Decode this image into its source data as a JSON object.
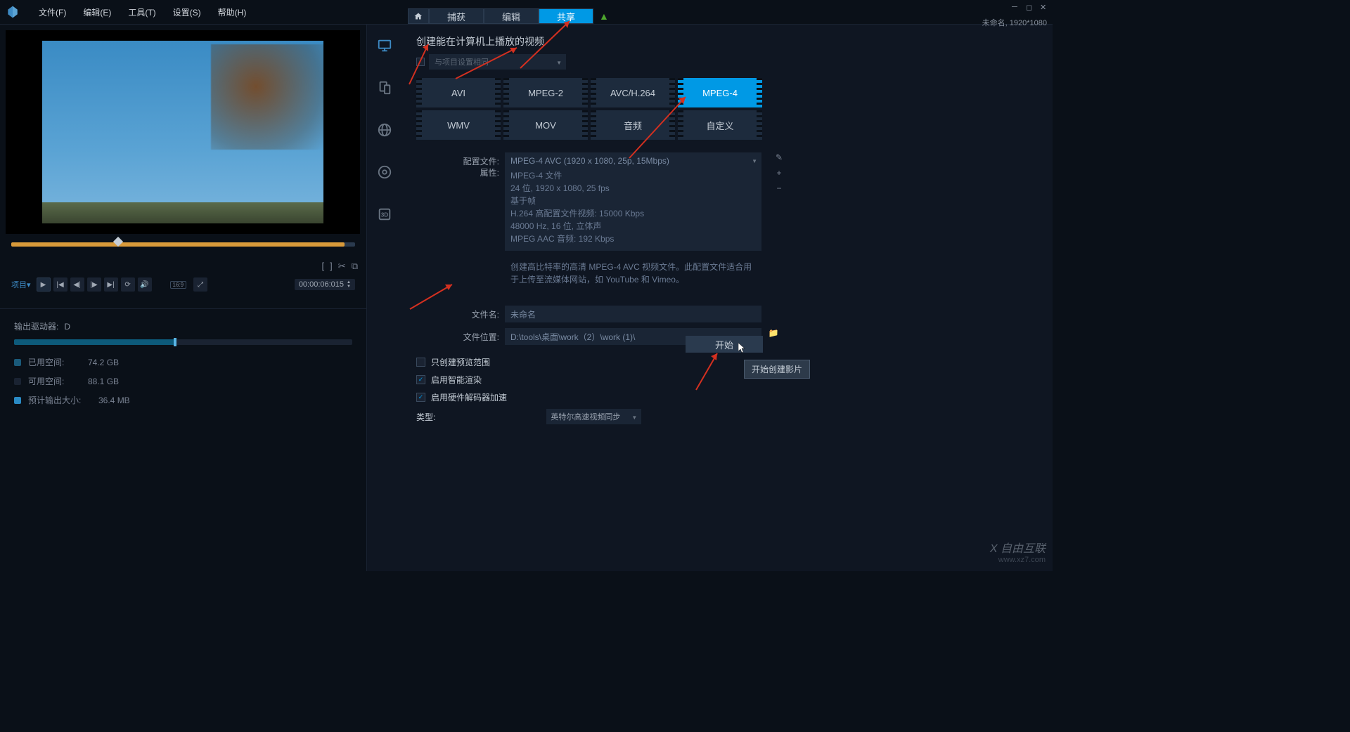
{
  "menu": {
    "file": "文件(F)",
    "edit": "编辑(E)",
    "tools": "工具(T)",
    "settings": "设置(S)",
    "help": "帮助(H)"
  },
  "top_tabs": {
    "capture": "捕获",
    "edit": "编辑",
    "share": "共享"
  },
  "project_info": "未命名, 1920*1080",
  "playback": {
    "project_label": "项目",
    "timecode": "00:00:06:015",
    "aspect": "16:9"
  },
  "disk": {
    "drive_label": "输出驱动器:",
    "drive_value": "D",
    "used_label": "已用空间:",
    "used_value": "74.2 GB",
    "free_label": "可用空间:",
    "free_value": "88.1 GB",
    "output_label": "预计输出大小:",
    "output_value": "36.4 MB"
  },
  "section": {
    "title": "创建能在计算机上播放的视频",
    "same_as_project": "与项目设置相同"
  },
  "formats": {
    "avi": "AVI",
    "mpeg2": "MPEG-2",
    "avc": "AVC/H.264",
    "mpeg4": "MPEG-4",
    "wmv": "WMV",
    "mov": "MOV",
    "audio": "音频",
    "custom": "自定义"
  },
  "form": {
    "profile_label": "配置文件:",
    "profile_value": "MPEG-4 AVC (1920 x 1080, 25p, 15Mbps)",
    "attr_label": "属性:",
    "attr_line1": "MPEG-4 文件",
    "attr_line2": "24 位, 1920 x 1080, 25 fps",
    "attr_line3": "基于帧",
    "attr_line4": "H.264 高配置文件视频: 15000 Kbps",
    "attr_line5": "48000 Hz, 16 位, 立体声",
    "attr_line6": "MPEG AAC 音频: 192 Kbps",
    "attr_desc": "创建高比特率的高清 MPEG-4 AVC 视频文件。此配置文件适合用于上传至流媒体网站，如 YouTube 和 Vimeo。",
    "filename_label": "文件名:",
    "filename_value": "未命名",
    "location_label": "文件位置:",
    "location_value": "D:\\tools\\桌面\\work（2）\\work (1)\\"
  },
  "checks": {
    "preview_only": "只创建预览范围",
    "smart_render": "启用智能渲染",
    "hw_decode": "启用硬件解码器加速",
    "type_label": "类型:",
    "type_value": "英特尔高速视频同步"
  },
  "start_button": "开始",
  "tooltip": "开始创建影片",
  "watermark": {
    "brand": "X 自由互联",
    "url": "www.xz7.com"
  }
}
